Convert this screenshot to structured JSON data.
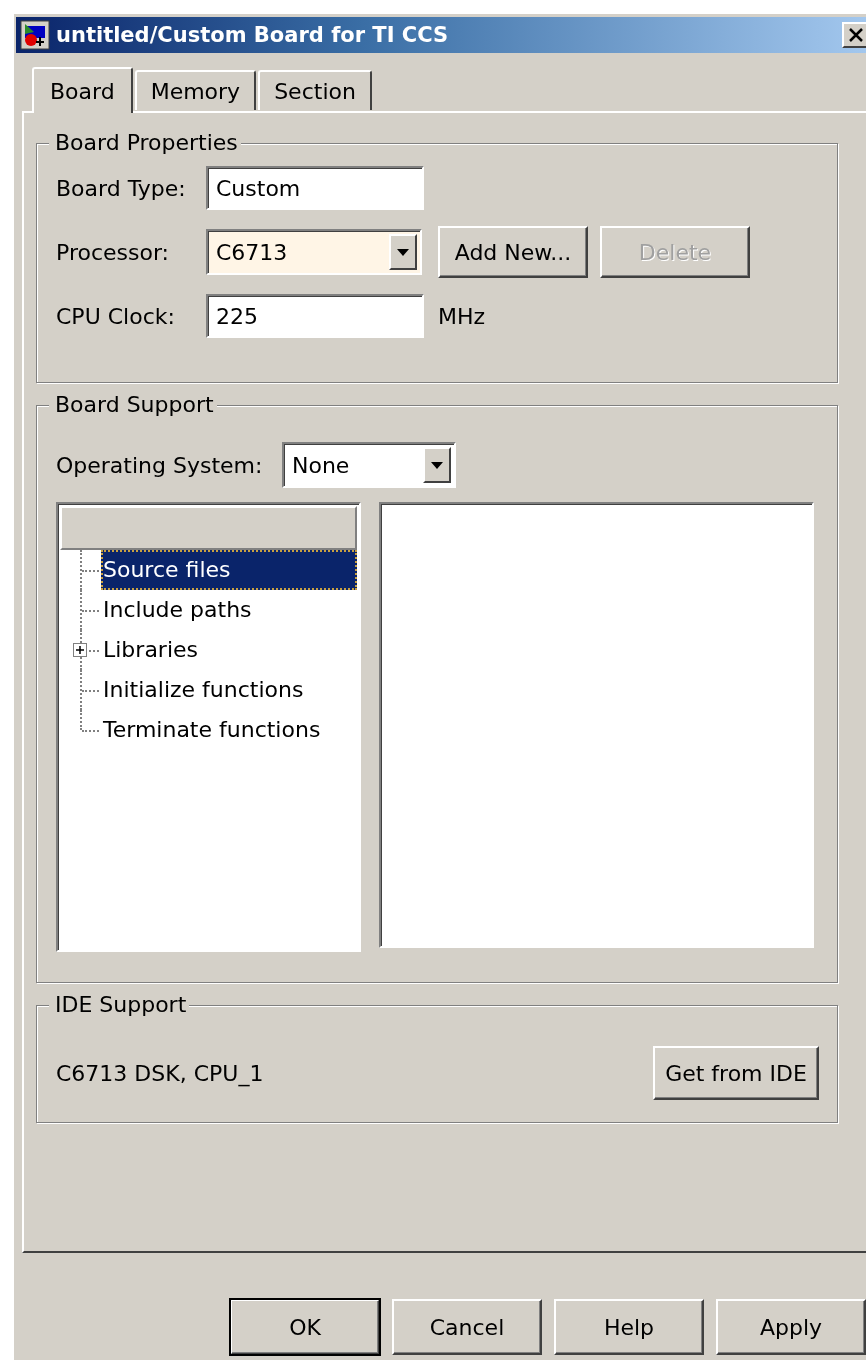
{
  "window": {
    "title": "untitled/Custom Board for TI CCS"
  },
  "tabs": [
    {
      "label": "Board",
      "selected": true
    },
    {
      "label": "Memory",
      "selected": false
    },
    {
      "label": "Section",
      "selected": false
    }
  ],
  "board_properties": {
    "title": "Board Properties",
    "board_type": {
      "label": "Board Type:",
      "value": "Custom",
      "highlighted": false
    },
    "processor": {
      "label": "Processor:",
      "value": "C6713",
      "highlighted": true
    },
    "add_new": {
      "label": "Add New...",
      "disabled": false
    },
    "delete": {
      "label": "Delete",
      "disabled": true
    },
    "cpu_clock": {
      "label": "CPU Clock:",
      "value": "225",
      "unit": "MHz",
      "highlighted": false
    }
  },
  "board_support": {
    "title": "Board Support",
    "operating_system": {
      "label": "Operating System:",
      "value": "None"
    },
    "tree": [
      {
        "label": "Source files",
        "selected": true
      },
      {
        "label": "Include paths",
        "selected": false
      },
      {
        "label": "Libraries",
        "selected": false,
        "expanded": false
      },
      {
        "label": "Initialize functions",
        "selected": false
      },
      {
        "label": "Terminate functions",
        "selected": false
      }
    ]
  },
  "ide_support": {
    "title": "IDE Support",
    "text": "C6713 DSK, CPU_1",
    "button": "Get from IDE"
  },
  "buttons": [
    {
      "label": "OK",
      "default": true
    },
    {
      "label": "Cancel",
      "default": false
    },
    {
      "label": "Help",
      "default": false
    },
    {
      "label": "Apply",
      "default": false
    }
  ]
}
